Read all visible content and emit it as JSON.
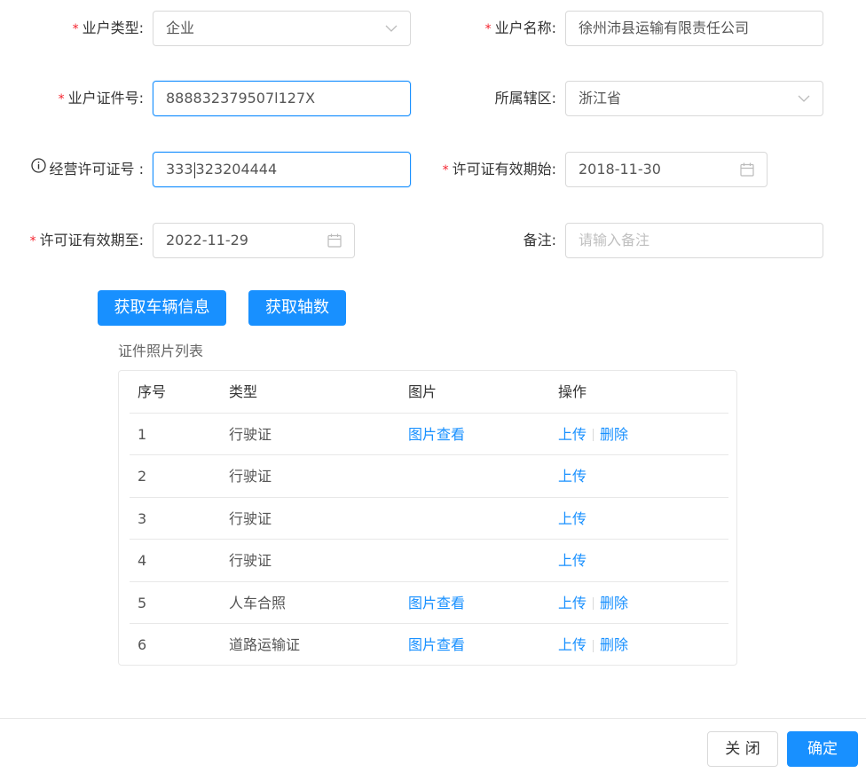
{
  "form": {
    "owner_type": {
      "label": "业户类型:",
      "value": "企业"
    },
    "owner_name": {
      "label": "业户名称:",
      "value": "徐州沛县运输有限责任公司"
    },
    "owner_cert_no": {
      "label": "业户证件号:",
      "value": "888832379507l127X"
    },
    "district": {
      "label": "所属辖区:",
      "value": "浙江省"
    },
    "business_license_no": {
      "label": "经营许可证号 :",
      "value_before_caret": "333",
      "value_after_caret": "323204444"
    },
    "license_valid_from": {
      "label": "许可证有效期始:",
      "value": "2018-11-30"
    },
    "license_valid_to": {
      "label": "许可证有效期至:",
      "value": "2022-11-29"
    },
    "remark": {
      "label": "备注:",
      "placeholder": "请输入备注"
    },
    "required_mark": "*"
  },
  "actions": {
    "get_vehicle_info": "获取车辆信息",
    "get_axle_count": "获取轴数"
  },
  "photo_list": {
    "title": "证件照片列表",
    "columns": [
      "序号",
      "类型",
      "图片",
      "操作"
    ],
    "rows": [
      {
        "no": "1",
        "type": "行驶证",
        "image": "图片查看",
        "upload": "上传",
        "delete": "删除"
      },
      {
        "no": "2",
        "type": "行驶证",
        "image": "",
        "upload": "上传",
        "delete": ""
      },
      {
        "no": "3",
        "type": "行驶证",
        "image": "",
        "upload": "上传",
        "delete": ""
      },
      {
        "no": "4",
        "type": "行驶证",
        "image": "",
        "upload": "上传",
        "delete": ""
      },
      {
        "no": "5",
        "type": "人车合照",
        "image": "图片查看",
        "upload": "上传",
        "delete": "删除"
      },
      {
        "no": "6",
        "type": "道路运输证",
        "image": "图片查看",
        "upload": "上传",
        "delete": "删除"
      }
    ]
  },
  "footer": {
    "close": "关 闭",
    "confirm": "确定"
  },
  "colors": {
    "primary": "#1890ff",
    "required": "#f5222d",
    "border": "#d9d9d9"
  }
}
